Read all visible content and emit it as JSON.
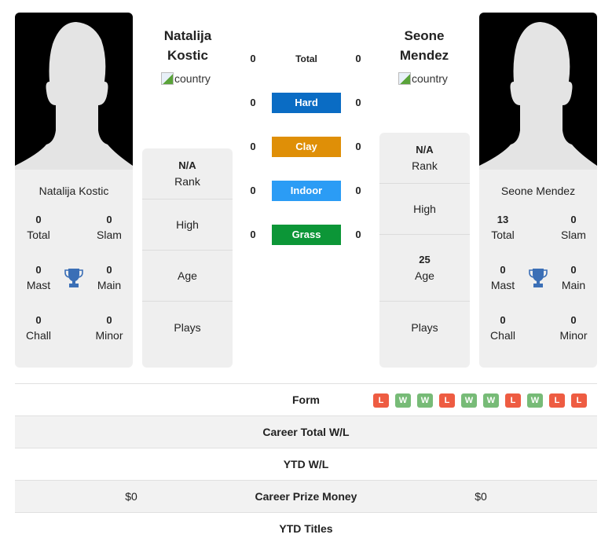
{
  "player_left": {
    "name": "Natalija Kostic",
    "name_line1": "Natalija",
    "name_line2": "Kostic",
    "country_alt": "country",
    "titles": {
      "total": {
        "value": "0",
        "label": "Total"
      },
      "slam": {
        "value": "0",
        "label": "Slam"
      },
      "mast": {
        "value": "0",
        "label": "Mast"
      },
      "main": {
        "value": "0",
        "label": "Main"
      },
      "chall": {
        "value": "0",
        "label": "Chall"
      },
      "minor": {
        "value": "0",
        "label": "Minor"
      }
    },
    "info": {
      "rank": {
        "value": "N/A",
        "label": "Rank"
      },
      "high": {
        "value": "",
        "label": "High"
      },
      "age": {
        "value": "",
        "label": "Age"
      },
      "plays": {
        "value": "",
        "label": "Plays"
      }
    }
  },
  "player_right": {
    "name": "Seone Mendez",
    "name_line1": "Seone",
    "name_line2": "Mendez",
    "country_alt": "country",
    "titles": {
      "total": {
        "value": "13",
        "label": "Total"
      },
      "slam": {
        "value": "0",
        "label": "Slam"
      },
      "mast": {
        "value": "0",
        "label": "Mast"
      },
      "main": {
        "value": "0",
        "label": "Main"
      },
      "chall": {
        "value": "0",
        "label": "Chall"
      },
      "minor": {
        "value": "0",
        "label": "Minor"
      }
    },
    "info": {
      "rank": {
        "value": "N/A",
        "label": "Rank"
      },
      "high": {
        "value": "",
        "label": "High"
      },
      "age": {
        "value": "25",
        "label": "Age"
      },
      "plays": {
        "value": "",
        "label": "Plays"
      }
    }
  },
  "h2h": [
    {
      "label": "Total",
      "left": "0",
      "right": "0",
      "color": ""
    },
    {
      "label": "Hard",
      "left": "0",
      "right": "0",
      "color": "#0a6cc4"
    },
    {
      "label": "Clay",
      "left": "0",
      "right": "0",
      "color": "#df8f07"
    },
    {
      "label": "Indoor",
      "left": "0",
      "right": "0",
      "color": "#2b9cf5"
    },
    {
      "label": "Grass",
      "left": "0",
      "right": "0",
      "color": "#0c9637"
    }
  ],
  "comparison": {
    "form_label": "Form",
    "form": [
      "L",
      "W",
      "W",
      "L",
      "W",
      "W",
      "L",
      "W",
      "L",
      "L"
    ],
    "form_colors": {
      "W": "#77bb77",
      "L": "#ee5c42"
    },
    "rows": [
      {
        "label": "Career Total W/L",
        "left": "",
        "right": ""
      },
      {
        "label": "YTD W/L",
        "left": "",
        "right": ""
      },
      {
        "label": "Career Prize Money",
        "left": "$0",
        "right": "$0"
      },
      {
        "label": "YTD Titles",
        "left": "",
        "right": ""
      }
    ]
  },
  "colors": {
    "trophy": "#3b6fb6",
    "card_bg": "#efefef"
  }
}
